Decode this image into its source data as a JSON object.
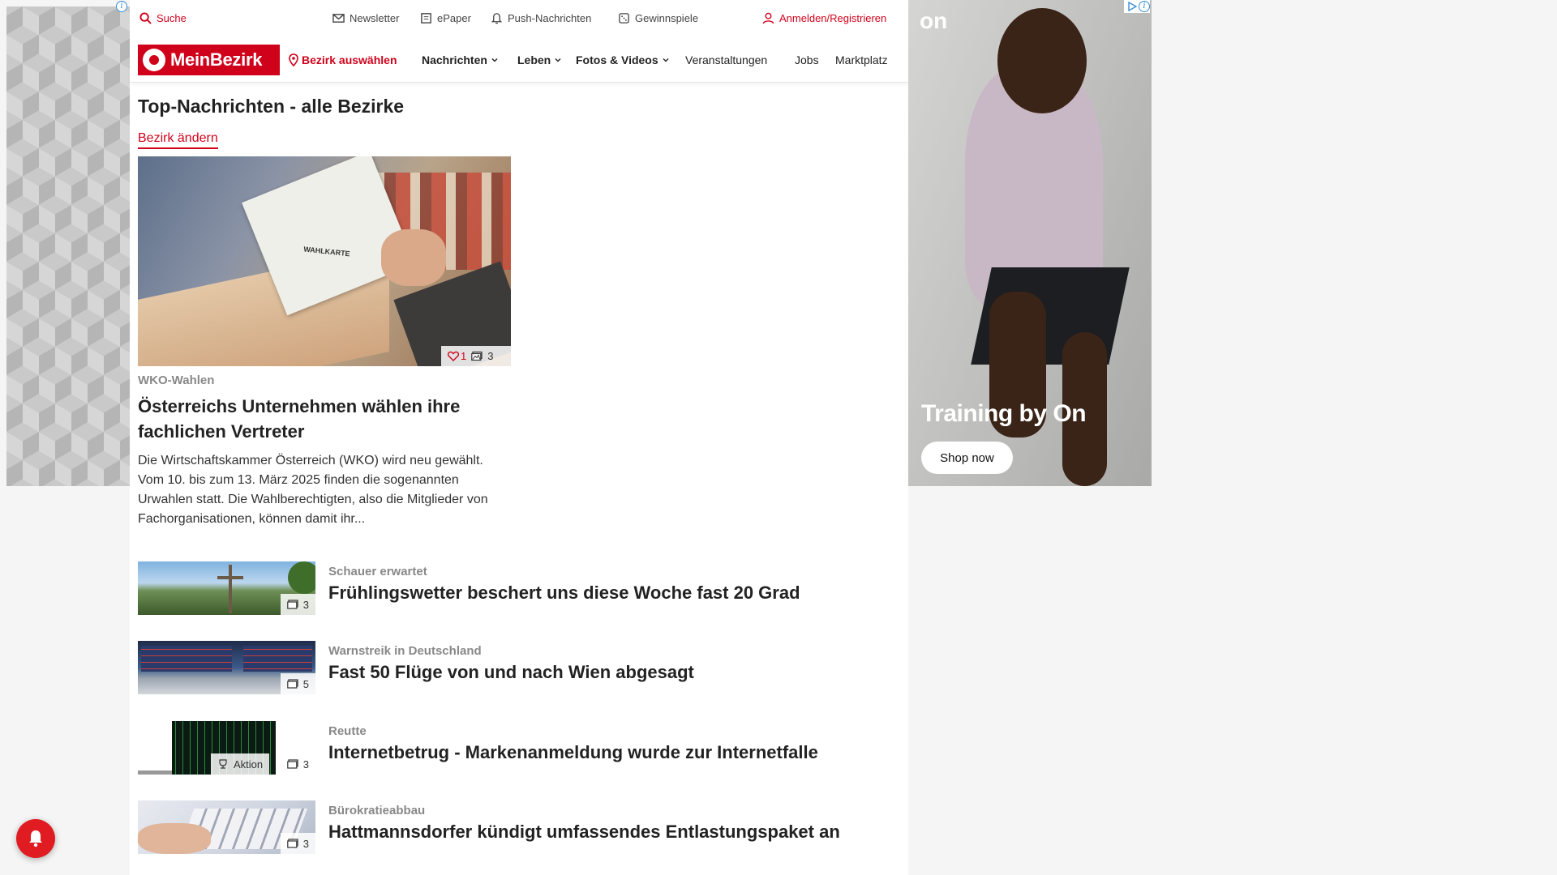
{
  "topbar": {
    "search": "Suche",
    "newsletter": "Newsletter",
    "epaper": "ePaper",
    "push": "Push-Nachrichten",
    "contests": "Gewinnspiele",
    "login": "Anmelden/Registrieren"
  },
  "navbar": {
    "logo": "MeinBezirk",
    "select_district": "Bezirk auswählen",
    "items": [
      "Nachrichten",
      "Leben",
      "Fotos & Videos",
      "Veranstaltungen",
      "Jobs",
      "Marktplatz"
    ]
  },
  "page": {
    "title": "Top-Nachrichten - alle Bezirke",
    "change_district": "Bezirk ändern"
  },
  "hero": {
    "image_caption": "WAHLKARTE",
    "likes": "1",
    "photos": "3",
    "topic": "WKO-Wahlen",
    "title": "Österreichs Unternehmen wählen ihre fachlichen Vertreter",
    "teaser": "Die Wirtschaftskammer Österreich (WKO) wird neu gewählt. Vom 10. bis zum 13. März 2025 finden die sogenannten Urwahlen statt. Die Wahlberechtigten, also die Mitglieder von Fachorganisationen, können damit ihr..."
  },
  "articles": [
    {
      "topic": "Schauer erwartet",
      "title": "Frühlingswetter beschert uns diese Woche fast 20 Grad",
      "photos": "3"
    },
    {
      "topic": "Warnstreik in Deutschland",
      "title": "Fast 50 Flüge von und nach Wien abgesagt",
      "photos": "5"
    },
    {
      "topic": "Reutte",
      "title": "Internetbetrug - Markenanmeldung wurde zur Internetfalle",
      "photos": "3",
      "badge": "Aktion"
    },
    {
      "topic": "Bürokratieabbau",
      "title": "Hattmannsdorfer kündigt umfassendes Entlastungspaket an",
      "photos": "3"
    }
  ],
  "ad": {
    "brand": "on",
    "headline": "Training by On",
    "cta": "Shop now"
  },
  "colors": {
    "brand_red": "#d0021b",
    "topic_gray": "#888888"
  }
}
